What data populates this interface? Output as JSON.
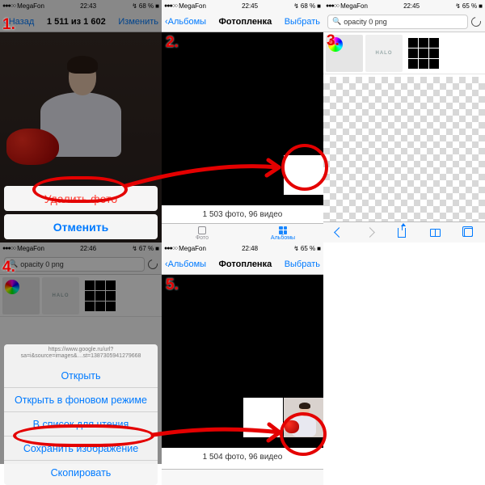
{
  "steps": {
    "s1": "1.",
    "s2": "2.",
    "s3": "3.",
    "s4": "4.",
    "s5": "5."
  },
  "status": {
    "carrier": "MegaFon",
    "dots": "●●●○○",
    "t1": "22:43",
    "t2": "22:45",
    "t3": "22:45",
    "t4": "22:46",
    "t5": "22:48",
    "batt1": "68 %",
    "batt2": "68 %",
    "batt3": "65 %",
    "batt4": "67 %",
    "batt5": "65 %",
    "chg": "↯"
  },
  "p1": {
    "back": "Назад",
    "counter": "1 511 из 1 602",
    "edit": "Изменить",
    "delete": "Удалить фото",
    "cancel": "Отменить"
  },
  "p2": {
    "back": "Альбомы",
    "title": "Фотопленка",
    "select": "Выбрать",
    "footer": "1 503 фото, 96 видео",
    "tab_photos": "Фото",
    "tab_albums": "Альбомы"
  },
  "p3": {
    "query": "opacity 0 png",
    "halo": "HALO"
  },
  "p4": {
    "query": "opacity 0 png",
    "url_top": "https://www.google.ru/url?",
    "url_bottom": "sa=i&source=images&…st=1387305941279668",
    "open": "Открыть",
    "open_bg": "Открыть в фоновом режиме",
    "reading": "В список для чтения",
    "save": "Сохранить изображение",
    "copy": "Скопировать"
  },
  "p5": {
    "back": "Альбомы",
    "title": "Фотопленка",
    "select": "Выбрать",
    "footer": "1 504 фото, 96 видео"
  }
}
